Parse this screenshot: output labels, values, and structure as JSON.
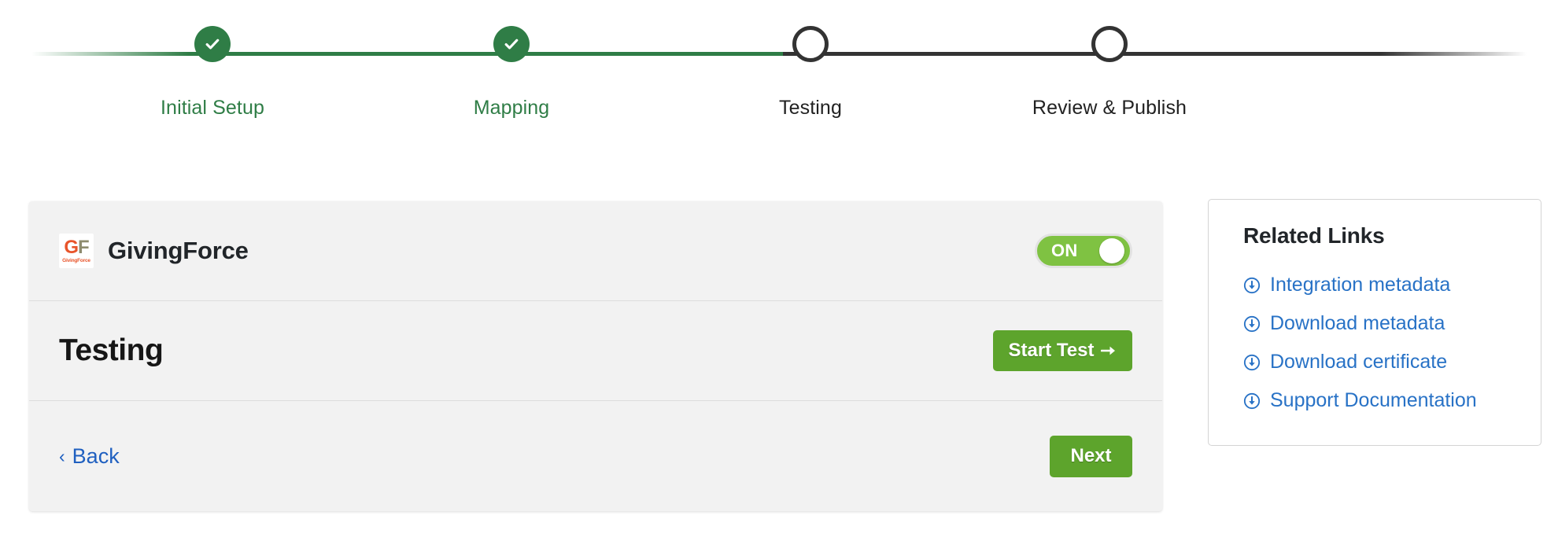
{
  "colors": {
    "green_done": "#2f7d46",
    "pending_dark": "#333333",
    "button_green": "#5da42c",
    "toggle_green": "#7fc242",
    "link_blue": "#2872c6",
    "back_blue": "#2060c0",
    "card_bg": "#f2f2f2",
    "logo_orange": "#e8542a",
    "logo_olive": "#8d8b6e"
  },
  "stepper": {
    "steps": [
      {
        "label": "Initial Setup",
        "state": "done",
        "icon": "check-icon"
      },
      {
        "label": "Mapping",
        "state": "done",
        "icon": "check-icon"
      },
      {
        "label": "Testing",
        "state": "pending",
        "icon": "empty-circle-icon"
      },
      {
        "label": "Review & Publish",
        "state": "pending",
        "icon": "empty-circle-icon"
      }
    ]
  },
  "card": {
    "header": {
      "logo": {
        "icon": "givingforce-logo-icon",
        "mark_g": "G",
        "mark_f": "F",
        "wordmark": "GivingForce"
      },
      "integration_name": "GivingForce",
      "toggle": {
        "label": "ON",
        "state": "on",
        "icon": "toggle-switch-icon"
      }
    },
    "body": {
      "section_title": "Testing",
      "start_test_label": "Start Test",
      "start_test_icon": "arrow-right-icon"
    },
    "footer": {
      "back_label": "Back",
      "back_icon": "chevron-left-icon",
      "next_label": "Next"
    }
  },
  "related_links": {
    "title": "Related Links",
    "items": [
      {
        "label": "Integration metadata",
        "icon": "download-circle-icon"
      },
      {
        "label": "Download metadata",
        "icon": "download-circle-icon"
      },
      {
        "label": "Download certificate",
        "icon": "download-circle-icon"
      },
      {
        "label": "Support Documentation",
        "icon": "download-circle-icon"
      }
    ]
  }
}
